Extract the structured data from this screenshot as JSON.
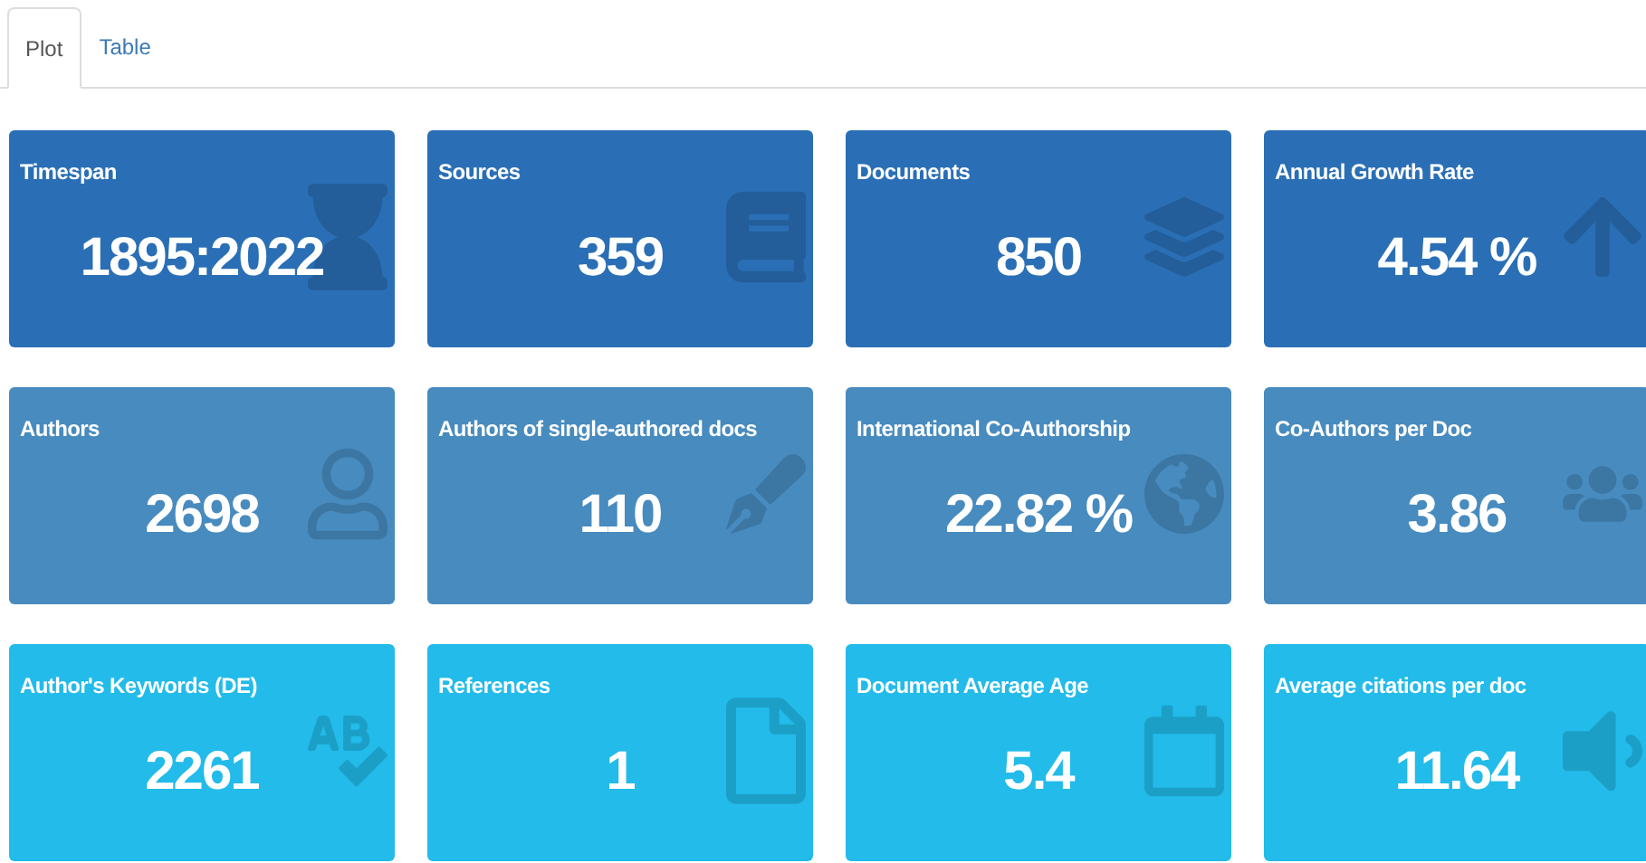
{
  "tabs": [
    {
      "label": "Plot",
      "selected": true
    },
    {
      "label": "Table",
      "selected": false
    }
  ],
  "cards": [
    {
      "title": "Timespan",
      "value": "1895:2022",
      "color": "#2a6fb5"
    },
    {
      "title": "Sources",
      "value": "359",
      "color": "#2a6fb5"
    },
    {
      "title": "Documents",
      "value": "850",
      "color": "#2a6fb5"
    },
    {
      "title": "Annual Growth Rate",
      "value": "4.54 %",
      "color": "#2a6fb5"
    },
    {
      "title": "Authors",
      "value": "2698",
      "color": "#478bbf"
    },
    {
      "title": "Authors of single-authored docs",
      "value": "110",
      "color": "#478bbf"
    },
    {
      "title": "International Co-Authorship",
      "value": "22.82 %",
      "color": "#478bbf"
    },
    {
      "title": "Co-Authors per Doc",
      "value": "3.86",
      "color": "#478bbf"
    },
    {
      "title": "Author's Keywords (DE)",
      "value": "2261",
      "color": "#22bbea"
    },
    {
      "title": "References",
      "value": "1",
      "color": "#22bbea"
    },
    {
      "title": "Document Average Age",
      "value": "5.4",
      "color": "#22bbea"
    },
    {
      "title": "Average citations per doc",
      "value": "11.64",
      "color": "#22bbea"
    }
  ]
}
